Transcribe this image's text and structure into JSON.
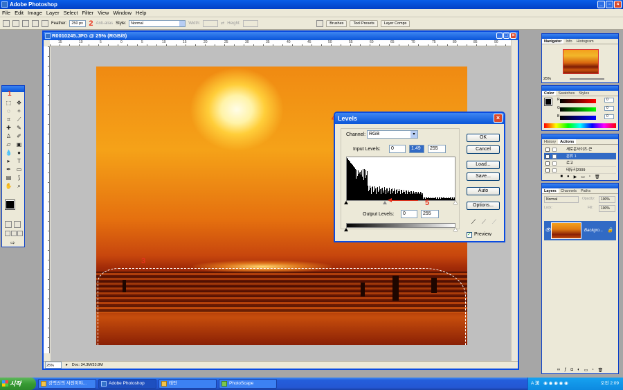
{
  "app": {
    "title": "Adobe Photoshop"
  },
  "menu": [
    "File",
    "Edit",
    "Image",
    "Layer",
    "Select",
    "Filter",
    "View",
    "Window",
    "Help"
  ],
  "options": {
    "feather_label": "Feather:",
    "feather_value": "250 px",
    "antialias_label": "Anti-alias",
    "style_label": "Style:",
    "style_value": "Normal",
    "width_label": "Width:",
    "height_label": "Height:",
    "wells": [
      "Brushes",
      "Tool Presets",
      "Layer Comps"
    ]
  },
  "annotations": {
    "n1": "1",
    "n2": "2",
    "n3": "3",
    "n4": "4",
    "n5": "5"
  },
  "document": {
    "title": "R0010245.JPG @ 25% (RGB/8)",
    "zoom": "25%",
    "doc_size": "Doc: 34.3M/33.8M",
    "ruler_numbers": [
      "15",
      "10",
      "5",
      "0",
      "5",
      "10",
      "15",
      "20",
      "25",
      "30",
      "35",
      "40",
      "45",
      "50",
      "55",
      "60",
      "65",
      "70",
      "75",
      "80",
      "85",
      "90"
    ]
  },
  "levels": {
    "title": "Levels",
    "channel_label": "Channel:",
    "channel_value": "RGB",
    "input_label": "Input Levels:",
    "input_black": "0",
    "input_gamma": "1.49",
    "input_white": "255",
    "output_label": "Output Levels:",
    "output_black": "0",
    "output_white": "255",
    "buttons": {
      "ok": "OK",
      "cancel": "Cancel",
      "load": "Load...",
      "save": "Save...",
      "auto": "Auto",
      "options": "Options..."
    },
    "preview_label": "Preview",
    "preview_checked": true
  },
  "panels": {
    "navigator": {
      "tabs": [
        "Navigator",
        "Info",
        "Histogram"
      ],
      "zoom": "25%"
    },
    "color": {
      "tabs": [
        "Color",
        "Swatches",
        "Styles"
      ],
      "r": "0",
      "g": "0",
      "b": "0"
    },
    "history": {
      "tabs": [
        "History",
        "Actions"
      ],
      "items": [
        "새로운사이즈-큰",
        "분류 1",
        "로고",
        "테두리2009"
      ]
    },
    "layers": {
      "tabs": [
        "Layers",
        "Channels",
        "Paths"
      ],
      "blend": "Normal",
      "opacity_label": "Opacity:",
      "opacity": "100%",
      "lock_label": "Lock:",
      "fill_label": "Fill:",
      "fill": "100%",
      "layer_name": "Backgro..."
    }
  },
  "taskbar": {
    "start": "시작",
    "items": [
      "강력신의 사진이야...",
      "Adobe Photoshop",
      "태안",
      "PhotoScape"
    ],
    "ime": "A 漢",
    "clock": "오전 2:09"
  }
}
